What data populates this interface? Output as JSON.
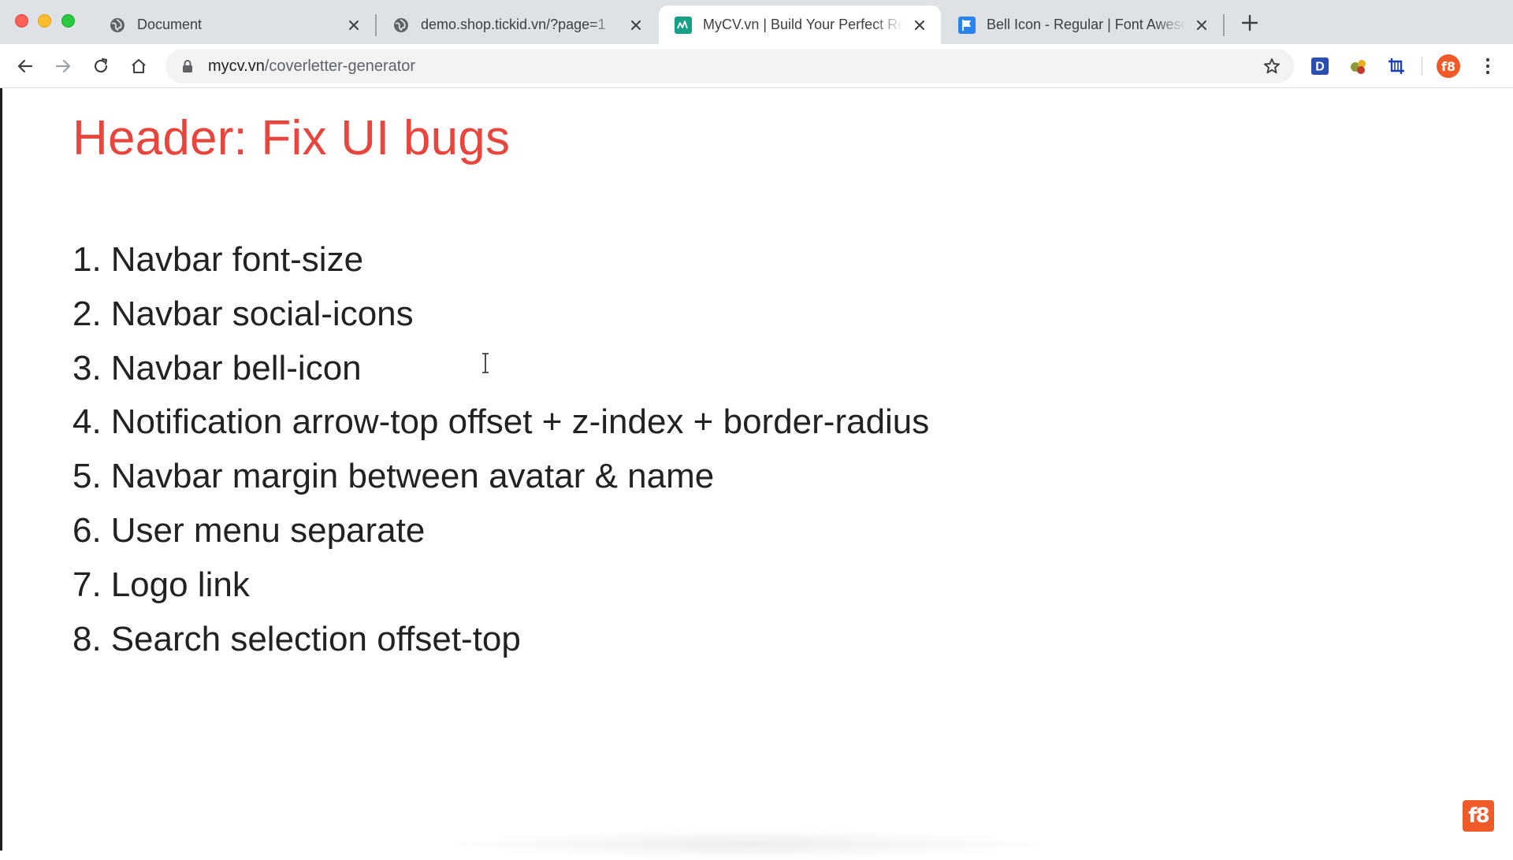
{
  "browser": {
    "tabs": [
      {
        "title": "Document",
        "favicon": "globe-icon",
        "active": false
      },
      {
        "title": "demo.shop.tickid.vn/?page=1",
        "favicon": "globe-icon",
        "active": false
      },
      {
        "title": "MyCV.vn | Build Your Perfect Resume",
        "favicon": "mycv-logo-icon",
        "active": true
      },
      {
        "title": "Bell Icon - Regular | Font Awesome",
        "favicon": "font-awesome-flag-icon",
        "active": false
      }
    ],
    "address": {
      "host": "mycv.vn",
      "path": "/coverletter-generator"
    },
    "extensions": [
      {
        "name": "D",
        "icon": "d-extension-icon",
        "color": "#2b4fb0"
      },
      {
        "name": "",
        "icon": "color-dots-extension-icon"
      },
      {
        "name": "",
        "icon": "crop-extension-icon",
        "color": "#1a3fbf"
      }
    ],
    "profile_icon": "f8-profile-avatar"
  },
  "page": {
    "heading": "Header: Fix UI bugs",
    "heading_color": "#e8453c",
    "items": [
      {
        "num": "1.",
        "text": "Navbar font-size"
      },
      {
        "num": "2.",
        "text": "Navbar social-icons"
      },
      {
        "num": "3.",
        "text": "Navbar bell-icon"
      },
      {
        "num": "4.",
        "text": "Notification arrow-top offset + z-index + border-radius"
      },
      {
        "num": "5.",
        "text": "Navbar margin between avatar & name"
      },
      {
        "num": "6.",
        "text": "User menu separate"
      },
      {
        "num": "7.",
        "text": "Logo link"
      },
      {
        "num": "8.",
        "text": "Search selection offset-top"
      }
    ],
    "watermark": "f8"
  }
}
